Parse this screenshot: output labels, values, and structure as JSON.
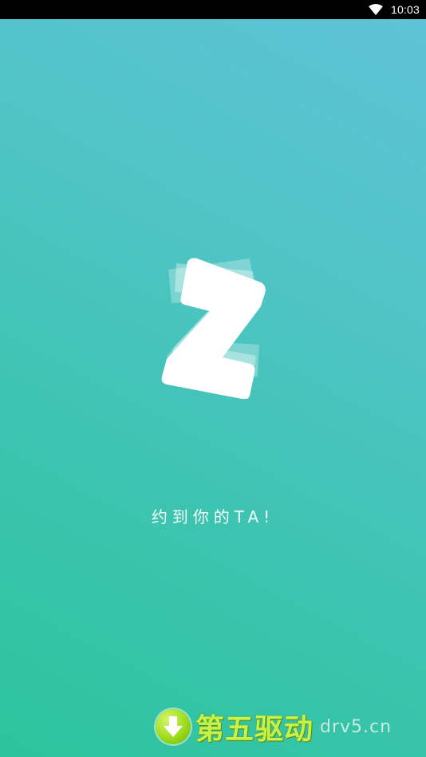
{
  "status_bar": {
    "time": "10:03",
    "wifi_icon": "wifi-icon"
  },
  "splash": {
    "logo_icon": "z-logo-icon",
    "tagline": "约到你的TA!",
    "colors": {
      "gradient_top": "#5ec3d6",
      "gradient_bottom": "#2cc49c",
      "logo": "#ffffff"
    }
  },
  "watermark": {
    "icon": "download-arrow-icon",
    "title": "第五驱动",
    "domain": "drv5.cn",
    "color": "#c6f24a"
  }
}
